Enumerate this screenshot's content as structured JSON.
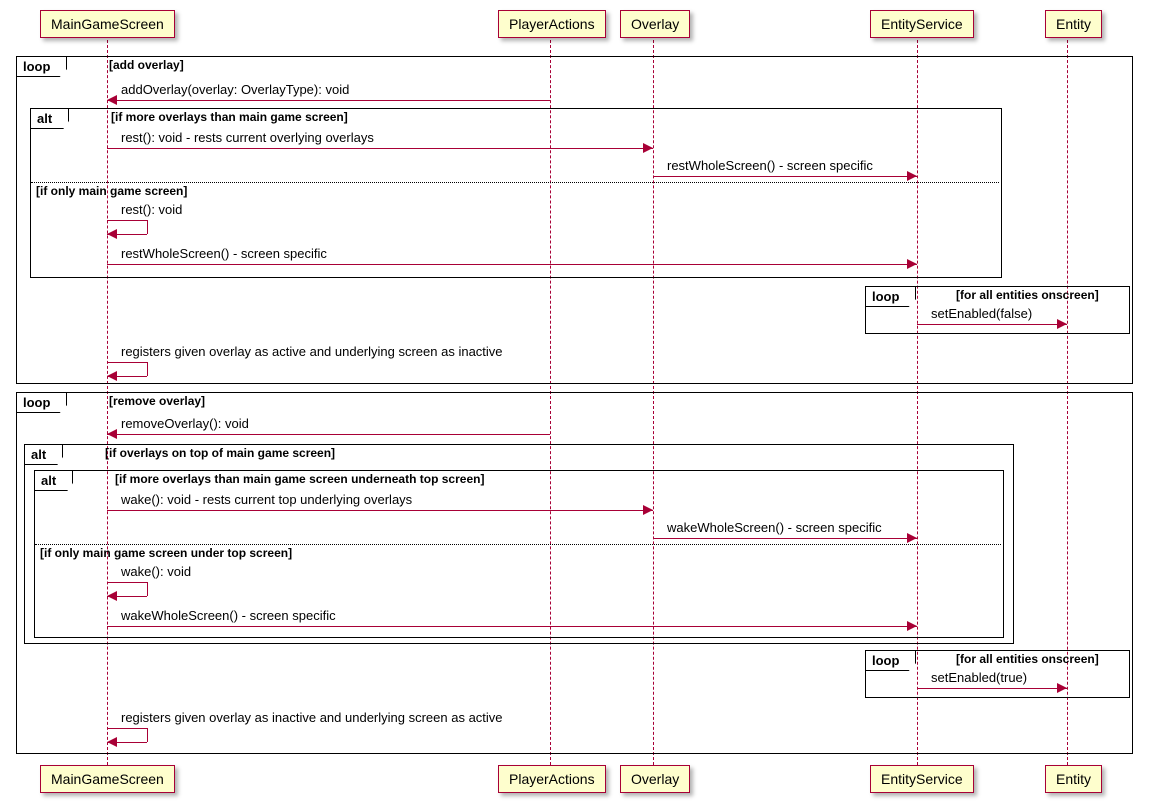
{
  "participants": {
    "p0": "MainGameScreen",
    "p1": "PlayerActions",
    "p2": "Overlay",
    "p3": "EntityService",
    "p4": "Entity"
  },
  "frames": {
    "loop1": {
      "label": "loop",
      "cond": "[add overlay]"
    },
    "alt1": {
      "label": "alt",
      "cond": "[if more overlays than main game screen]"
    },
    "alt1_else": "[if only main game screen]",
    "loop2": {
      "label": "loop",
      "cond": "[for all entities onscreen]"
    },
    "loop3": {
      "label": "loop",
      "cond": "[remove overlay]"
    },
    "alt2": {
      "label": "alt",
      "cond": "[if overlays on top of main game screen]"
    },
    "alt3": {
      "label": "alt",
      "cond": "[if more overlays than main game screen underneath top screen]"
    },
    "alt3_else": "[if only main game screen under top screen]",
    "loop4": {
      "label": "loop",
      "cond": "[for all entities onscreen]"
    }
  },
  "messages": {
    "m1": "addOverlay(overlay: OverlayType): void",
    "m2": "rest(): void - rests current overlying overlays",
    "m3": "restWholeScreen() - screen specific",
    "m4": "rest(): void",
    "m5": "restWholeScreen() - screen specific",
    "m6": "setEnabled(false)",
    "m7": "registers given overlay as active and underlying screen as inactive",
    "m8": "removeOverlay(): void",
    "m9": "wake(): void - rests current top underlying overlays",
    "m10": "wakeWholeScreen() - screen specific",
    "m11": "wake(): void",
    "m12": "wakeWholeScreen() - screen specific",
    "m13": "setEnabled(true)",
    "m14": "registers given overlay as inactive and underlying screen as active"
  }
}
